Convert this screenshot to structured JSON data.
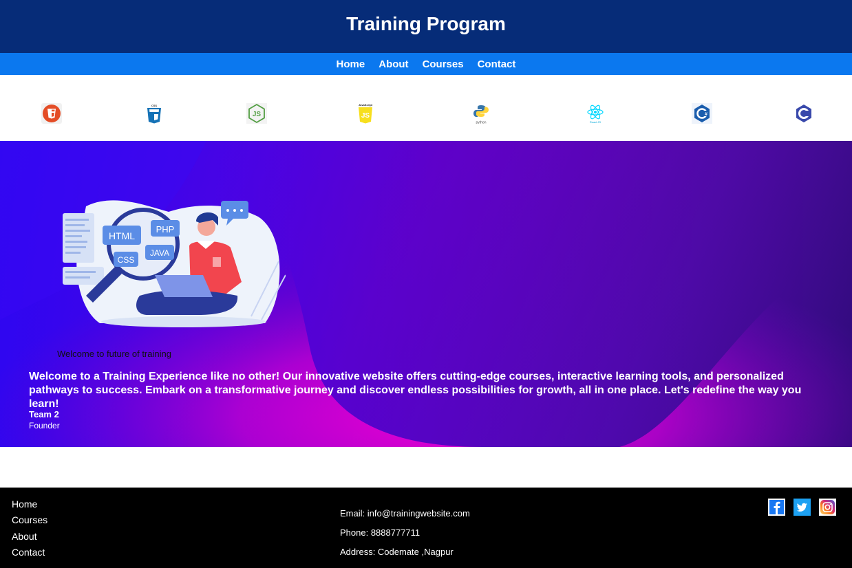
{
  "header": {
    "title": "Training Program"
  },
  "nav": {
    "items": [
      "Home",
      "About",
      "Courses",
      "Contact"
    ]
  },
  "logos": {
    "items": [
      "html5-icon",
      "css3-icon",
      "nodejs-icon",
      "javascript-icon",
      "python-icon",
      "react-icon",
      "csharp-icon",
      "c-icon"
    ],
    "css_label": "CSS",
    "js_label": "JavaScript",
    "python_label": "python",
    "react_label": "React JS"
  },
  "hero": {
    "tagline": "Welcome to future of training",
    "quote": "Welcome to a Training Experience like no other! Our innovative website offers cutting-edge courses, interactive learning tools, and personalized pathways to success. Embark on a transformative journey and discover endless possibilities for growth, all in one place. Let's redefine the way you learn!",
    "author": "Team 2",
    "role": "Founder",
    "illustration_tags": [
      "HTML",
      "PHP",
      "JAVA",
      "CSS"
    ]
  },
  "footer": {
    "links": [
      "Home",
      "Courses",
      "About",
      "Contact"
    ],
    "email": "Email: info@trainingwebsite.com",
    "phone": "Phone: 8888777711",
    "address": "Address: Codemate ,Nagpur",
    "social": [
      "facebook-icon",
      "twitter-icon",
      "instagram-icon"
    ]
  },
  "colors": {
    "header_bg": "#062c78",
    "nav_bg": "#0b78ef",
    "hero_pink": "#ff00d4",
    "hero_purple": "#3a05f0",
    "footer_bg": "#000000"
  }
}
